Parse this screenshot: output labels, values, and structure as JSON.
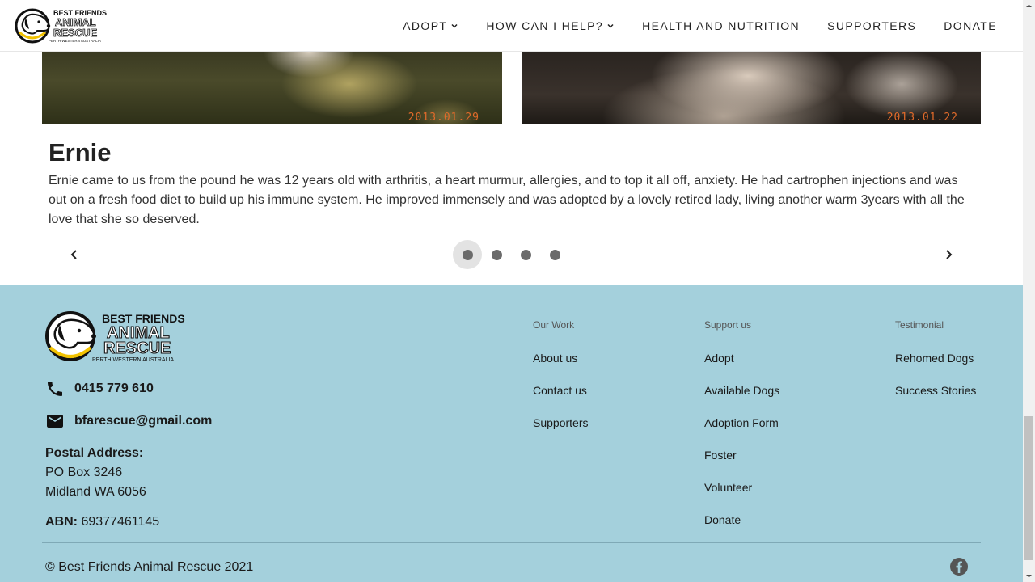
{
  "header": {
    "logo": {
      "line1": "BEST FRIENDS",
      "line2": "ANIMAL",
      "line3": "RESCUE",
      "line4": "PERTH WESTERN AUSTRALIA"
    },
    "nav": [
      {
        "label": "ADOPT",
        "has_dropdown": true
      },
      {
        "label": "HOW CAN I HELP?",
        "has_dropdown": true
      },
      {
        "label": "HEALTH AND NUTRITION",
        "has_dropdown": false
      },
      {
        "label": "SUPPORTERS",
        "has_dropdown": false
      },
      {
        "label": "DONATE",
        "has_dropdown": false
      }
    ]
  },
  "carousel": {
    "photos": [
      {
        "date": "2013.01.29"
      },
      {
        "date": "2013.01.22"
      }
    ],
    "name": "Ernie",
    "text": "Ernie came to us from the pound he was 12 years old with arthritis, a heart murmur, allergies, and to top it all off, anxiety. He had cartrophen injections and was out on a fresh food diet to build up his immune system. He improved immensely and was adopted by a lovely retired lady, living another warm 3years with all the love that she so deserved.",
    "dot_count": 4,
    "active_dot": 1
  },
  "footer": {
    "logo": {
      "line1": "BEST FRIENDS",
      "line2": "ANIMAL",
      "line3": "RESCUE",
      "line4": "PERTH WESTERN AUSTRALIA"
    },
    "phone": "0415 779 610",
    "email": "bfarescue@gmail.com",
    "postal_label": "Postal Address:",
    "postal_line1": "PO Box 3246",
    "postal_line2": "Midland WA 6056",
    "abn_label": "ABN:",
    "abn_value": "69377461145",
    "columns": [
      {
        "heading": "Our Work",
        "links": [
          "About us",
          "Contact us",
          "Supporters"
        ]
      },
      {
        "heading": "Support us",
        "links": [
          "Adopt",
          "Available Dogs",
          "Adoption Form",
          "Foster",
          "Volunteer",
          "Donate"
        ]
      },
      {
        "heading": "Testimonial",
        "links": [
          "Rehomed Dogs",
          "Success Stories"
        ]
      }
    ],
    "copyright": "© Best Friends Animal Rescue 2021"
  },
  "colors": {
    "footer_bg": "#a4d0dc",
    "text": "#222222",
    "dot": "#6b6b6b",
    "logo_yellow": "#f2c200"
  }
}
